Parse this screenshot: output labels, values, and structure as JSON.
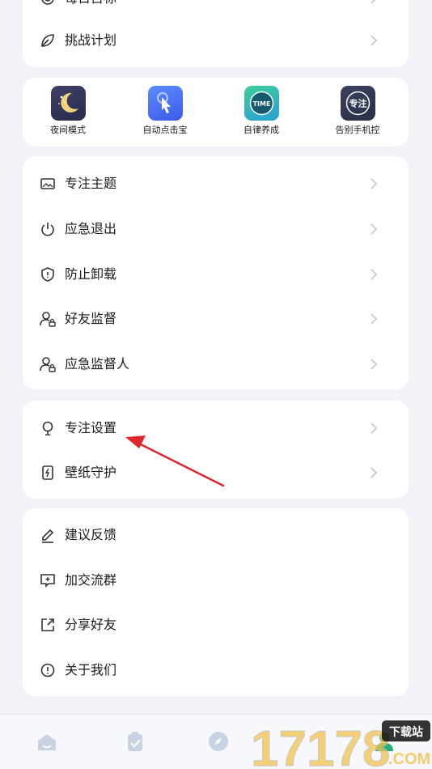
{
  "menu_top": {
    "items": [
      {
        "icon": "target-icon",
        "label": "每日目标"
      },
      {
        "icon": "leaf-icon",
        "label": "挑战计划"
      }
    ]
  },
  "tools": [
    {
      "icon": "moon-app-icon",
      "label": "夜间模式",
      "colors": [
        "#3d3f66",
        "#2a2c4d"
      ]
    },
    {
      "icon": "tap-app-icon",
      "label": "自动点击宝",
      "colors": [
        "#5b8cff",
        "#3c5be8"
      ]
    },
    {
      "icon": "time-app-icon",
      "label": "自律养成",
      "colors": [
        "#3ecf9a",
        "#2a9fd6"
      ],
      "text": "TIME"
    },
    {
      "icon": "focus-app-icon",
      "label": "告别手机控",
      "colors": [
        "#39415e",
        "#2b3148"
      ],
      "text": "专注"
    }
  ],
  "menu_focus": {
    "items": [
      {
        "icon": "image-icon",
        "label": "专注主题"
      },
      {
        "icon": "power-icon",
        "label": "应急退出"
      },
      {
        "icon": "shield-icon",
        "label": "防止卸载"
      },
      {
        "icon": "user-lock-icon",
        "label": "好友监督"
      },
      {
        "icon": "user-lock-icon",
        "label": "应急监督人"
      }
    ]
  },
  "menu_settings": {
    "items": [
      {
        "icon": "bulb-icon",
        "label": "专注设置"
      },
      {
        "icon": "phone-bolt-icon",
        "label": "壁纸守护"
      }
    ]
  },
  "menu_other": {
    "items": [
      {
        "icon": "pen-icon",
        "label": "建议反馈"
      },
      {
        "icon": "chat-plus-icon",
        "label": "加交流群"
      },
      {
        "icon": "share-icon",
        "label": "分享好友"
      },
      {
        "icon": "info-icon",
        "label": "关于我们"
      }
    ]
  },
  "tabs": [
    {
      "icon": "home-icon"
    },
    {
      "icon": "clipboard-icon"
    },
    {
      "icon": "compass-icon"
    },
    {
      "icon": "profile-icon"
    }
  ],
  "watermark": {
    "number": "17178",
    "badge": "下载站",
    "suffix": ".COM"
  },
  "colors": {
    "card": "#ffffff",
    "bg": "#f1f3f9",
    "arrow": "#e0262a",
    "icon": "#333333",
    "chevron": "#c4c6cc"
  }
}
